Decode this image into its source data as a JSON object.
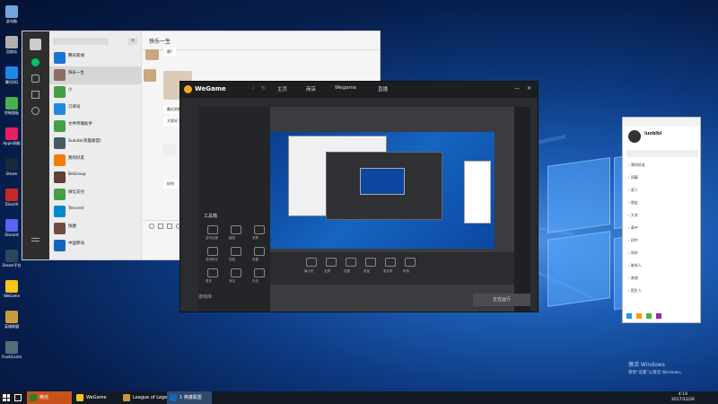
{
  "desktop_icons": [
    {
      "label": "此电脑",
      "color": "#6fa8dc"
    },
    {
      "label": "回收站",
      "color": "#b0b0b0"
    },
    {
      "label": "腾讯QQ",
      "color": "#1e88e5"
    },
    {
      "label": "控制面板",
      "color": "#4caf50"
    },
    {
      "label": "Apple网络",
      "color": "#e91e63"
    },
    {
      "label": "Steam",
      "color": "#1b2838"
    },
    {
      "label": "DirectX",
      "color": "#c62828"
    },
    {
      "label": "Discord",
      "color": "#5865f2"
    },
    {
      "label": "Steam平台",
      "color": "#2a475e"
    },
    {
      "label": "WeGame",
      "color": "#f5c518"
    },
    {
      "label": "英雄联盟",
      "color": "#c89b3c"
    },
    {
      "label": "FlashCenter",
      "color": "#546e7a"
    }
  ],
  "wechat": {
    "title": "快乐一生",
    "chats": [
      {
        "name": "腾讯新闻",
        "preview": "",
        "color": "#1976d2"
      },
      {
        "name": "快乐一生",
        "preview": "",
        "color": "#8d6e63"
      },
      {
        "name": "小",
        "preview": "",
        "color": "#43a047"
      },
      {
        "name": "订阅号",
        "preview": "",
        "color": "#1e88e5"
      },
      {
        "name": "文件传输助手",
        "preview": "",
        "color": "#43a047"
      },
      {
        "name": "Sukida(英雄联盟)",
        "preview": "",
        "color": "#455a64"
      },
      {
        "name": "我的好友",
        "preview": "",
        "color": "#f57c00"
      },
      {
        "name": "BeGroup",
        "preview": "",
        "color": "#5d4037"
      },
      {
        "name": "微信支付",
        "preview": "",
        "color": "#43a047"
      },
      {
        "name": "Tencent",
        "preview": "",
        "color": "#0288d1"
      },
      {
        "name": "快捷",
        "preview": "",
        "color": "#6d4c41"
      },
      {
        "name": "中国移动",
        "preview": "",
        "color": "#1565c0"
      }
    ],
    "messages": [
      {
        "text": "嗯?"
      },
      {
        "text": "最近的照片"
      },
      {
        "text": "大家好了"
      },
      {
        "text": "好的"
      }
    ]
  },
  "wegame": {
    "logo": "WeGame",
    "tabs": [
      "主页",
      "商店",
      "Wegame",
      "直播"
    ],
    "tool_title": "工具箱",
    "bottom_left": "游戏库",
    "bottom_status": "正在运行",
    "tools": [
      "游戏加速",
      "截图",
      "录屏",
      "游戏助手",
      "性能",
      "设置",
      "更多",
      "商店",
      "礼包"
    ],
    "controls": [
      "最小化",
      "全屏",
      "设置",
      "音量",
      "麦克风",
      "声音"
    ]
  },
  "contact_panel": {
    "name": "luoblbl",
    "rows": [
      "我的好友",
      "同事",
      "家人",
      "朋友",
      "大学",
      "高中",
      "初中",
      "同学",
      "联系人",
      "其他",
      "陌生人"
    ]
  },
  "taskbar": {
    "items": [
      {
        "label": "微信",
        "color": "#2e7d32"
      },
      {
        "label": "WeGame",
        "color": "#f5c518"
      },
      {
        "label": "League of Legends",
        "color": "#c89b3c"
      },
      {
        "label": "1 英雄联盟",
        "color": "#1565c0"
      }
    ],
    "time": "4:14",
    "date": "2017/12/26"
  },
  "watermark": {
    "line1": "激活 Windows",
    "line2": "转到“设置”以激活 Windows。"
  }
}
